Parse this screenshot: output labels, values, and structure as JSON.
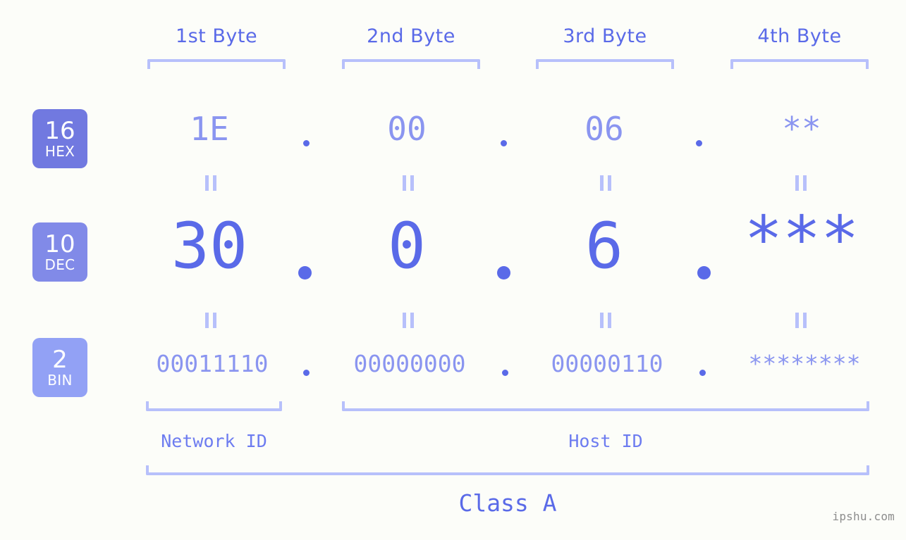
{
  "meta": {
    "background": "#fcfdf9",
    "accent_strong": "#5a6ae8",
    "accent_mid": "#8a95f0",
    "accent_light": "#b7c0fb",
    "watermark": "ipshu.com"
  },
  "columns": [
    {
      "header": "1st Byte"
    },
    {
      "header": "2nd Byte"
    },
    {
      "header": "3rd Byte"
    },
    {
      "header": "4th Byte"
    }
  ],
  "rows": {
    "hex": {
      "badge_number": "16",
      "badge_word": "HEX",
      "badge_color": "#7179e0",
      "values": [
        "1E",
        "00",
        "06",
        "**"
      ]
    },
    "dec": {
      "badge_number": "10",
      "badge_word": "DEC",
      "badge_color": "#818ae8",
      "values": [
        "30",
        "0",
        "6",
        "***"
      ]
    },
    "bin": {
      "badge_number": "2",
      "badge_word": "BIN",
      "badge_color": "#92a1f5",
      "values": [
        "00011110",
        "00000000",
        "00000110",
        "********"
      ]
    }
  },
  "separators": {
    "dot": ".",
    "equals": "="
  },
  "footer": {
    "network_id_label": "Network ID",
    "host_id_label": "Host ID",
    "class_label": "Class A"
  }
}
